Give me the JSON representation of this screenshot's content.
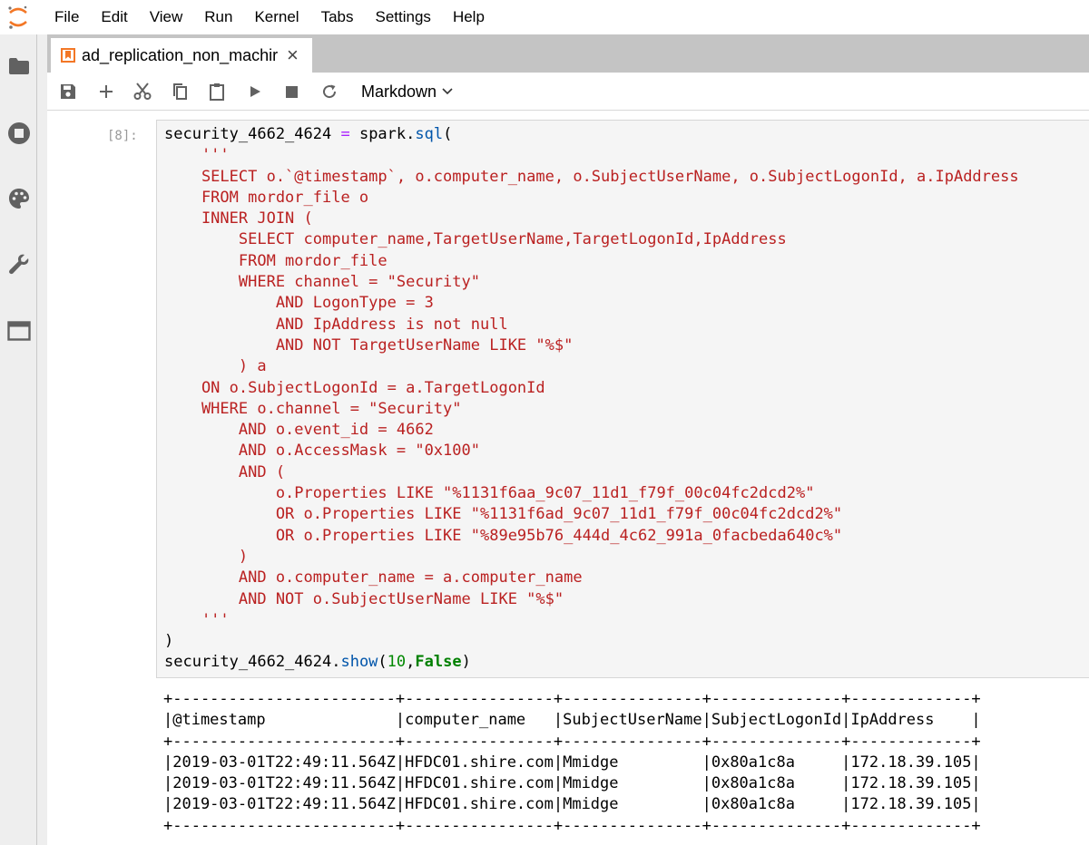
{
  "menubar": {
    "items": [
      "File",
      "Edit",
      "View",
      "Run",
      "Kernel",
      "Tabs",
      "Settings",
      "Help"
    ]
  },
  "sidebar": {
    "icons": [
      "folder-icon",
      "stop-circle-icon",
      "palette-icon",
      "wrench-icon",
      "tabs-icon"
    ]
  },
  "tab": {
    "label": "ad_replication_non_machir",
    "close": "×"
  },
  "toolbar": {
    "cell_type": "Markdown"
  },
  "cell": {
    "prompt": "[8]:",
    "code_lines": [
      "security_4662_4624 = spark.sql(",
      "    '''",
      "    SELECT o.`@timestamp`, o.computer_name, o.SubjectUserName, o.SubjectLogonId, a.IpAddress",
      "    FROM mordor_file o",
      "    INNER JOIN (",
      "        SELECT computer_name,TargetUserName,TargetLogonId,IpAddress",
      "        FROM mordor_file",
      "        WHERE channel = \"Security\"",
      "            AND LogonType = 3",
      "            AND IpAddress is not null",
      "            AND NOT TargetUserName LIKE \"%$\"",
      "        ) a",
      "    ON o.SubjectLogonId = a.TargetLogonId",
      "    WHERE o.channel = \"Security\"",
      "        AND o.event_id = 4662",
      "        AND o.AccessMask = \"0x100\"",
      "        AND (",
      "            o.Properties LIKE \"%1131f6aa_9c07_11d1_f79f_00c04fc2dcd2%\"",
      "            OR o.Properties LIKE \"%1131f6ad_9c07_11d1_f79f_00c04fc2dcd2%\"",
      "            OR o.Properties LIKE \"%89e95b76_444d_4c62_991a_0facbeda640c%\"",
      "        )",
      "        AND o.computer_name = a.computer_name",
      "        AND NOT o.SubjectUserName LIKE \"%$\"",
      "    '''",
      ")",
      "security_4662_4624.show(10,False)"
    ],
    "output_lines": [
      "+------------------------+----------------+---------------+--------------+-------------+",
      "|@timestamp              |computer_name   |SubjectUserName|SubjectLogonId|IpAddress    |",
      "+------------------------+----------------+---------------+--------------+-------------+",
      "|2019-03-01T22:49:11.564Z|HFDC01.shire.com|Mmidge         |0x80a1c8a     |172.18.39.105|",
      "|2019-03-01T22:49:11.564Z|HFDC01.shire.com|Mmidge         |0x80a1c8a     |172.18.39.105|",
      "|2019-03-01T22:49:11.564Z|HFDC01.shire.com|Mmidge         |0x80a1c8a     |172.18.39.105|",
      "+------------------------+----------------+---------------+--------------+-------------+"
    ]
  },
  "colors": {
    "keyword": "#aa22ff",
    "function": "#0055aa",
    "string": "#ba2121",
    "number": "#008800",
    "sidebar_bg": "#eeeeee",
    "tabbar_bg": "#c4c4c4",
    "cell_bg": "#f5f5f5",
    "logo_orange": "#f37726"
  }
}
